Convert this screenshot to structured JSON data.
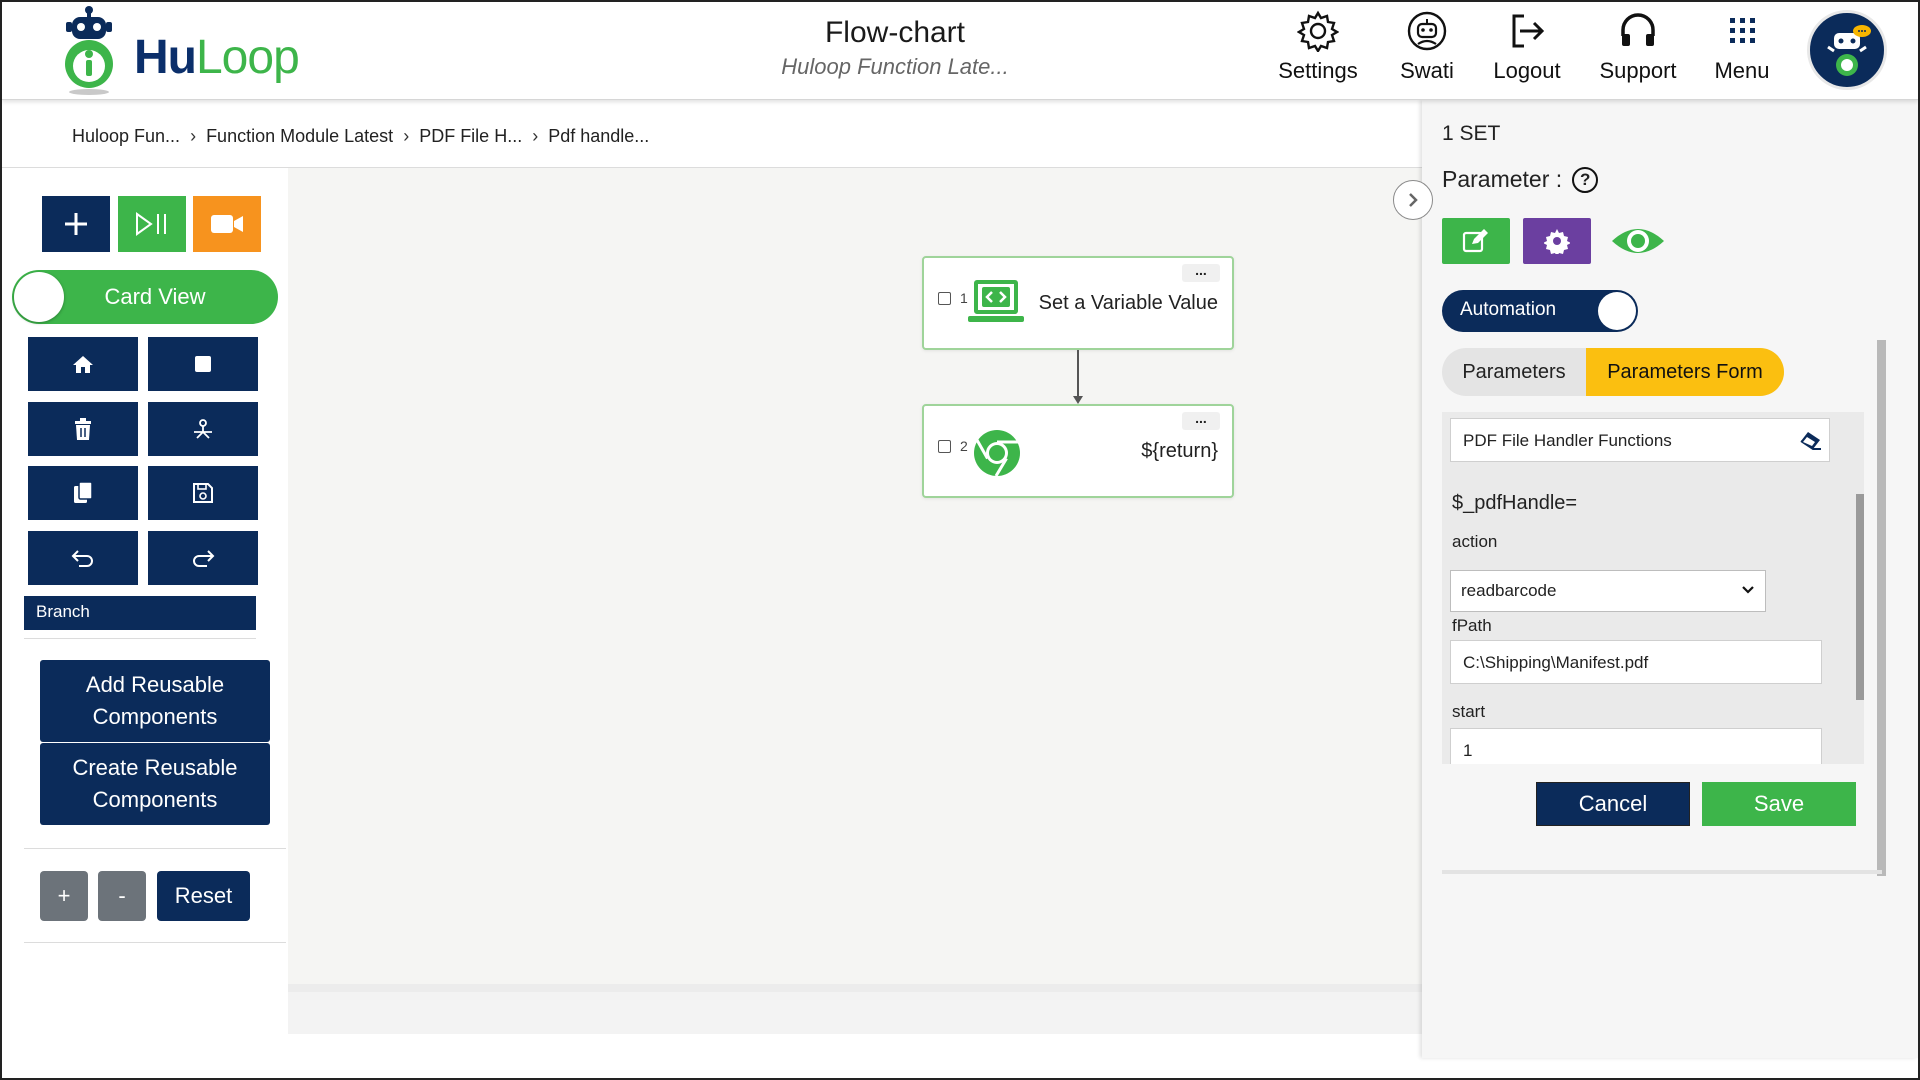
{
  "app": {
    "logo_part1": "Hu",
    "logo_part2": "Loop",
    "title": "Flow-chart",
    "subtitle": "Huloop Function Late...",
    "brand_navy": "#0b2b5a",
    "brand_green": "#3db54a",
    "accent_orange": "#f7931e",
    "accent_yellow": "#fbbf10"
  },
  "nav": {
    "items": [
      {
        "label": "Settings",
        "icon": "gear-icon"
      },
      {
        "label": "Swati",
        "icon": "user-robot-icon"
      },
      {
        "label": "Logout",
        "icon": "logout-icon"
      },
      {
        "label": "Support",
        "icon": "headphones-icon"
      },
      {
        "label": "Menu",
        "icon": "grid-menu-icon"
      }
    ]
  },
  "breadcrumb": [
    "Huloop Fun...",
    "Function Module Latest",
    "PDF File H...",
    "Pdf handle..."
  ],
  "left": {
    "card_view_label": "Card View",
    "branch_label": "Branch",
    "add_reusable": "Add Reusable Components",
    "create_reusable": "Create Reusable Components",
    "zoom_in": "+",
    "zoom_out": "-",
    "reset": "Reset"
  },
  "flow": {
    "nodes": [
      {
        "num": "1",
        "label": "Set a Variable Value",
        "icon": "variable-monitor-icon"
      },
      {
        "num": "2",
        "label": "${return}",
        "icon": "chrome-icon"
      }
    ]
  },
  "panel": {
    "step": "1 SET",
    "parameter_label": "Parameter :",
    "automation_label": "Automation",
    "tab_parameters": "Parameters",
    "tab_parameters_form": "Parameters Form",
    "function_name": "PDF File Handler Functions",
    "variable": "$_pdfHandle=",
    "action_label": "action",
    "action_value": "readbarcode",
    "fpath_label": "fPath",
    "fpath_value": "C:\\Shipping\\Manifest.pdf",
    "start_label": "start",
    "start_value": "1",
    "cancel": "Cancel",
    "save": "Save"
  }
}
